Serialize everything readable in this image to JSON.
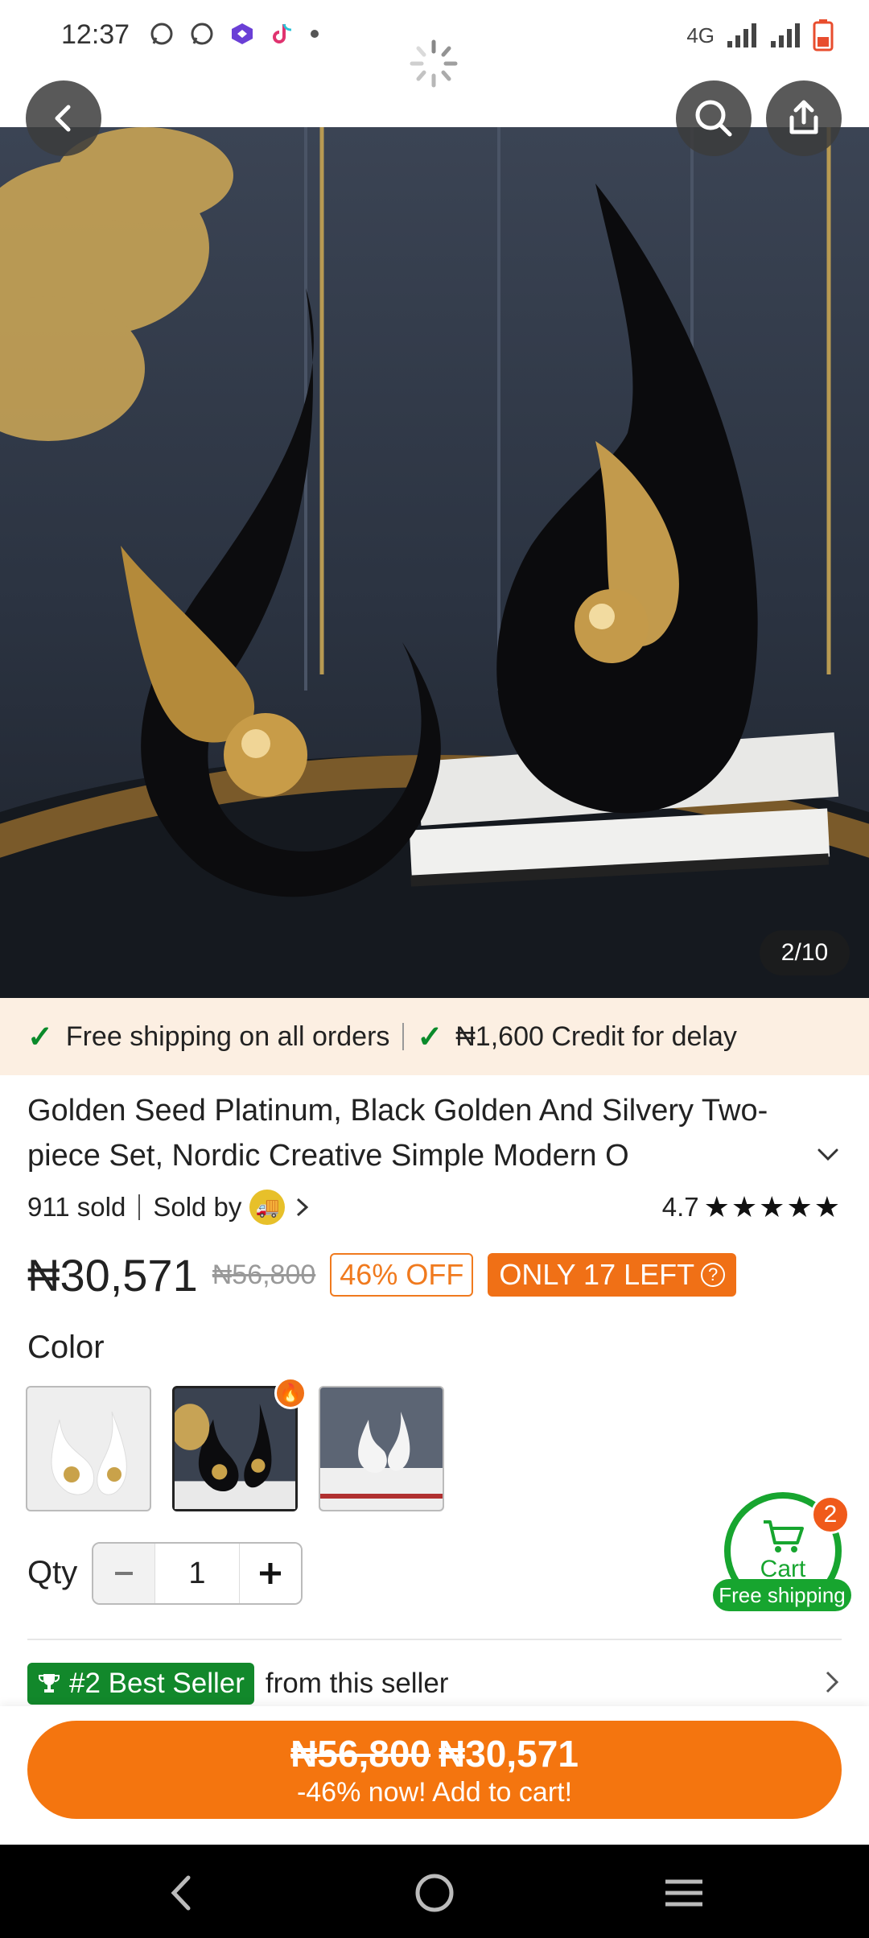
{
  "status_bar": {
    "time": "12:37",
    "network": "4G"
  },
  "product": {
    "image_counter": "2/10",
    "title": "Golden Seed Platinum, Black Golden And Silvery Two-piece Set, Nordic Creative Simple Modern O",
    "sold": "911 sold",
    "sold_by_label": "Sold by",
    "rating": "4.7",
    "stars": 4.7,
    "price": "₦30,571",
    "old_price": "₦56,800",
    "discount": "46% OFF",
    "stock": "ONLY 17 LEFT"
  },
  "promo": {
    "free_shipping": "Free shipping on all orders",
    "credit": "₦1,600 Credit for delay"
  },
  "color": {
    "label": "Color",
    "options": [
      "white-gold",
      "black-gold",
      "white-silver"
    ],
    "selected_index": 1
  },
  "quantity": {
    "label": "Qty",
    "value": "1"
  },
  "cart": {
    "label": "Cart",
    "count": "2",
    "shipping": "Free shipping"
  },
  "best_seller": {
    "badge": "#2 Best Seller",
    "text": "from this seller"
  },
  "cta": {
    "old_price": "₦56,800",
    "price": "₦30,571",
    "subtitle": "-46% now! Add to cart!"
  },
  "colors": {
    "accent": "#f4750f",
    "green": "#17a52f",
    "promo_bg": "#fcefe2"
  }
}
